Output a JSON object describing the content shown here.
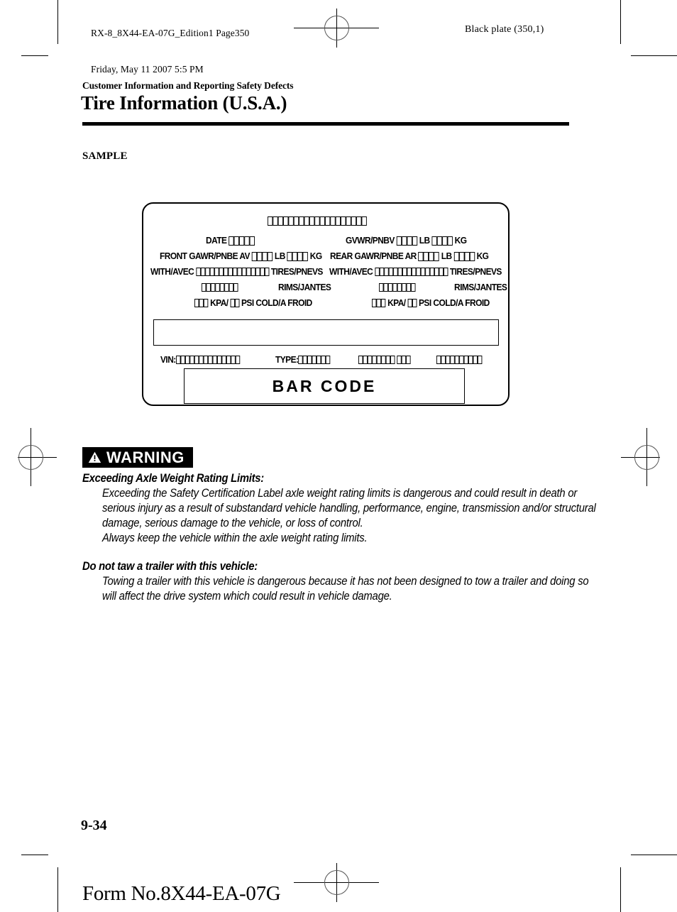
{
  "print_header": {
    "job_line1": "RX-8_8X44-EA-07G_Edition1 Page350",
    "job_line2": "Friday, May 11 2007 5:5 PM",
    "black_plate": "Black plate (350,1)"
  },
  "document": {
    "eyebrow": "Customer Information and Reporting Safety Defects",
    "title": "Tire Information (U.S.A.)",
    "sample_label": "SAMPLE"
  },
  "cert_label": {
    "rows": {
      "date_label": "DATE",
      "date_boxes": 5,
      "gvwr_label": "GVWR/PNBV",
      "gvwr_lb_boxes": 4,
      "gvwr_lb_unit": "LB",
      "gvwr_kg_boxes": 4,
      "gvwr_kg_unit": "KG",
      "front_gawr_label": "FRONT GAWR/PNBE AV",
      "front_lb_boxes": 4,
      "front_lb_unit": "LB",
      "front_kg_boxes": 4,
      "front_kg_unit": "KG",
      "rear_gawr_label": "REAR GAWR/PNBE AR",
      "rear_lb_boxes": 4,
      "rear_lb_unit": "LB",
      "rear_kg_boxes": 4,
      "rear_kg_unit": "KG",
      "with_avec_label": "WITH/AVEC",
      "tires_boxes": 16,
      "tires_label": "TIRES/PNEVS",
      "rims_boxes": 8,
      "rims_label": "RIMS/JANTES",
      "kpa_boxes": 3,
      "kpa_unit": "KPA/",
      "psi_boxes": 2,
      "psi_unit": "PSI",
      "cold_label": "COLD/A FROID",
      "top_boxes": 19,
      "vin_label": "VIN:",
      "vin_boxes": 14,
      "type_label": "TYPE:",
      "type_boxes": 7,
      "extra1_boxes": 8,
      "extra2_boxes": 3,
      "extra3_boxes": 10,
      "barcode_text": "BAR CODE"
    }
  },
  "warning": {
    "icon": "warning-triangle-icon",
    "banner_text": "WARNING",
    "banner_bg": "#000000",
    "banner_fg": "#ffffff",
    "sections": [
      {
        "heading": "Exceeding Axle Weight Rating Limits:",
        "paragraphs": [
          "Exceeding the Safety Certification Label axle weight rating limits is dangerous and could result in death or serious injury as a result of substandard vehicle handling, performance, engine, transmission and/or structural damage, serious damage to the vehicle, or loss of control.",
          "Always keep the vehicle within the axle weight rating limits."
        ]
      },
      {
        "heading": "Do not taw a trailer with this vehicle:",
        "paragraphs": [
          "Towing a trailer with this vehicle is dangerous because it has not been designed to tow a trailer and doing so will affect the drive system which could result in vehicle damage."
        ]
      }
    ]
  },
  "footer": {
    "page_number": "9-34",
    "form_number": "Form No.8X44-EA-07G"
  }
}
